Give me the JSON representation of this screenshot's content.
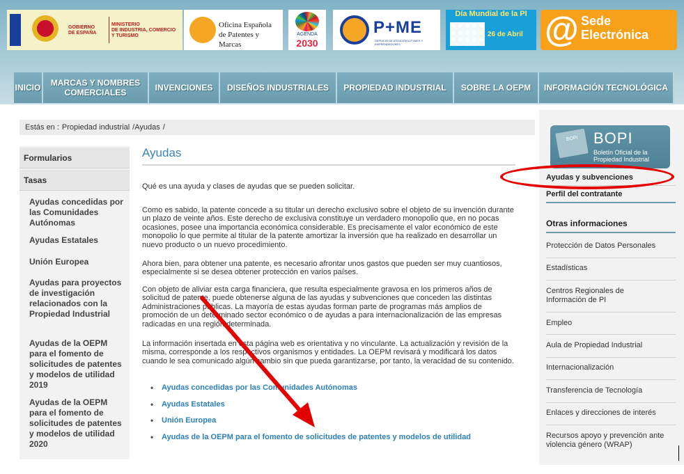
{
  "header": {
    "gobierno": {
      "line1": "GOBIERNO",
      "line2": "DE ESPAÑA"
    },
    "ministerio": {
      "line1": "MINISTERIO",
      "line2": "DE INDUSTRIA, COMERCIO",
      "line3": "Y TURISMO"
    },
    "oepm": {
      "line1": "Oficina Española",
      "line2": "de Patentes y Marcas"
    },
    "agenda": {
      "line1": "AGENDA",
      "line2": "2030"
    },
    "pyme": {
      "text": "P+ME",
      "sub": "SERVICIO DE ATENCIÓN A PYMES Y EMPRENDEDORES"
    },
    "dia_mundial": {
      "title": "Día Mundial de la PI",
      "date": "26 de Abril"
    },
    "sede": {
      "line1": "Sede",
      "line2": "Electrónica",
      "at": "@"
    }
  },
  "nav": {
    "items": [
      "INICIO",
      "MARCAS Y NOMBRES COMERCIALES",
      "INVENCIONES",
      "DISEÑOS INDUSTRIALES",
      "PROPIEDAD INDUSTRIAL",
      "SOBRE LA OEPM",
      "INFORMACIÓN TECNOLÓGICA"
    ]
  },
  "breadcrumb": {
    "prefix": "Estás en :",
    "items": [
      "Propiedad industrial",
      "/Ayudas",
      "/"
    ]
  },
  "leftnav": {
    "headings": [
      "Formularios",
      "Tasas"
    ],
    "items": [
      "Ayudas concedidas por las Comunidades Autónomas",
      "Ayudas Estatales",
      "Unión Europea",
      "Ayudas para proyectos de investigación relacionados con la Propiedad Industrial",
      "Ayudas de la OEPM para el fomento de solicitudes de patentes y modelos de utilidad 2019",
      "Ayudas de la OEPM para el fomento de solicitudes de patentes y modelos de utilidad 2020"
    ]
  },
  "main": {
    "title": "Ayudas",
    "intro": "Qué es una ayuda y clases de ayudas que se pueden solicitar.",
    "paragraphs": [
      "Como es sabido, la patente concede a su titular un derecho exclusivo sobre el objeto de su invención durante un plazo de veinte años. Este derecho de exclusiva constituye un verdadero monopolio que, en no pocas ocasiones, posee una importancia económica considerable. Es precisamente el valor económico de este monopolio lo que permite al titular de la patente amortizar la inversión que ha realizado en desarrollar un nuevo producto o un nuevo procedimiento.",
      "Ahora bien, para obtener una patente, es necesario afrontar unos gastos que pueden ser muy cuantiosos, especialmente si se desea obtener protección en varios países.",
      "Con objeto de aliviar esta carga financiera, que resulta especialmente gravosa en los primeros años de solicitud de patente, puede obtenerse alguna de las ayudas y subvenciones que conceden las distintas Administraciones públicas. La mayoría de estas ayudas forman parte de programas más amplios de promoción de un determinado sector económico o de ayudas a para internacionalización de las empresas radicadas en una región determinada.",
      "La información insertada en esta página web es orientativa y no vinculante. La actualización y revisión de la misma, corresponde a los respectivos organismos y entidades. La OEPM revisará y modificará los datos cuando le sea comunicado algún cambio sin que pueda garantizarse, por tanto, la veracidad de su contenido."
    ],
    "links": [
      "Ayudas concedidas por las Comunidades Autónomas",
      "Ayudas Estatales",
      "Unión Europea",
      "Ayudas de la OEPM para el fomento de solicitudes de patentes y modelos de utilidad"
    ]
  },
  "rightcol": {
    "bopi": {
      "book": "BOPI",
      "title": "BOPI",
      "sub1": "Boletín Oficial de la",
      "sub2": "Propiedad Industrial"
    },
    "link_ayudas": "Ayudas y subvenciones",
    "link_perfil": "Perfil del contratante",
    "otras_heading": "Otras informaciones",
    "items": [
      "Protección de Datos Personales",
      "Estadísticas",
      "Centros Regionales de Información de PI",
      "Empleo",
      "Aula de Propiedad Industrial",
      "Internacionalización",
      "Transferencia de Tecnología",
      "Enlaces y direcciones de interés",
      "Recursos apoyo y prevención ante violencia género (WRAP)"
    ]
  },
  "colors": {
    "accent": "#3a84b5",
    "link": "#2c7fb8",
    "annotation": "#e50000",
    "nav_bg": "#6b9cae"
  }
}
